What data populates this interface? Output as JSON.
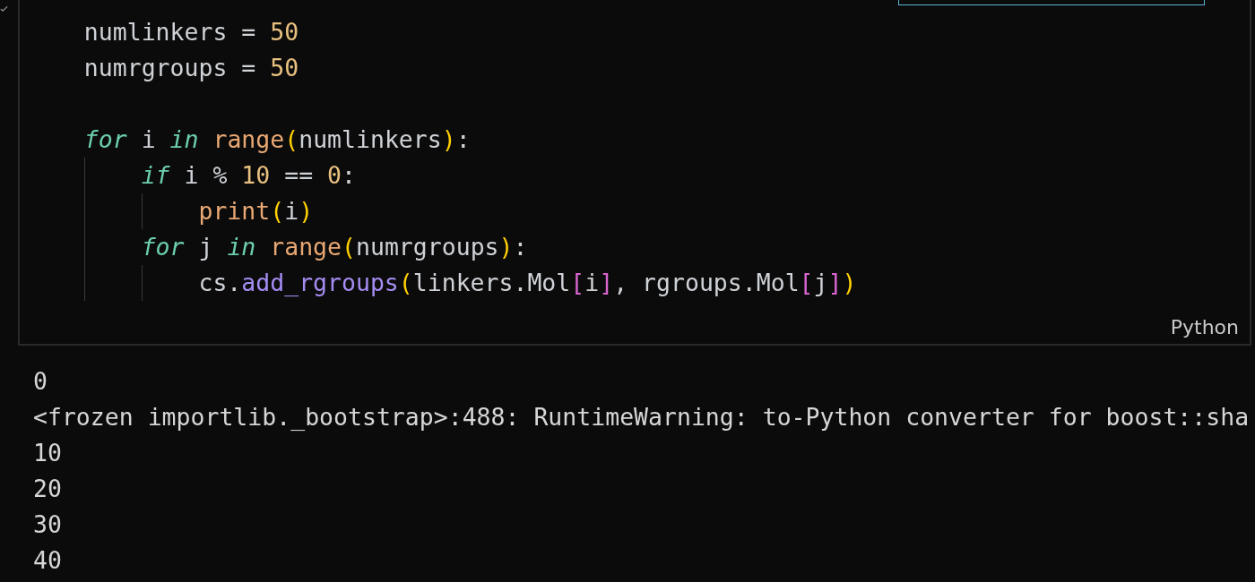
{
  "find_widget": {
    "visible": true
  },
  "cell": {
    "language": "Python",
    "code_lines": [
      {
        "kind": "code",
        "tokens": [
          {
            "kind": "plain",
            "text": "numlinkers = "
          },
          {
            "kind": "number",
            "text": "50"
          }
        ]
      },
      {
        "kind": "code",
        "tokens": [
          {
            "kind": "plain",
            "text": "numrgroups = "
          },
          {
            "kind": "number",
            "text": "50"
          }
        ]
      },
      {
        "kind": "blank"
      },
      {
        "kind": "code",
        "tokens": [
          {
            "kind": "keyword",
            "text": "for"
          },
          {
            "kind": "plain",
            "text": " i "
          },
          {
            "kind": "keyword",
            "text": "in"
          },
          {
            "kind": "function",
            "text": " range"
          },
          {
            "kind": "bracket1",
            "text": "("
          },
          {
            "kind": "plain",
            "text": "numlinkers"
          },
          {
            "kind": "bracket1",
            "text": ")"
          },
          {
            "kind": "plain",
            "text": ":"
          }
        ],
        "children": [
          {
            "kind": "code",
            "tokens": [
              {
                "kind": "keyword",
                "text": "if"
              },
              {
                "kind": "plain",
                "text": " i % "
              },
              {
                "kind": "number",
                "text": "10"
              },
              {
                "kind": "plain",
                "text": " == "
              },
              {
                "kind": "number",
                "text": "0"
              },
              {
                "kind": "plain",
                "text": ":"
              }
            ],
            "children": [
              {
                "kind": "code",
                "tokens": [
                  {
                    "kind": "function",
                    "text": "print"
                  },
                  {
                    "kind": "bracket1",
                    "text": "("
                  },
                  {
                    "kind": "plain",
                    "text": "i"
                  },
                  {
                    "kind": "bracket1",
                    "text": ")"
                  }
                ]
              }
            ]
          },
          {
            "kind": "code",
            "tokens": [
              {
                "kind": "keyword",
                "text": "for"
              },
              {
                "kind": "plain",
                "text": " j "
              },
              {
                "kind": "keyword",
                "text": "in"
              },
              {
                "kind": "function",
                "text": " range"
              },
              {
                "kind": "bracket1",
                "text": "("
              },
              {
                "kind": "plain",
                "text": "numrgroups"
              },
              {
                "kind": "bracket1",
                "text": ")"
              },
              {
                "kind": "plain",
                "text": ":"
              }
            ],
            "children": [
              {
                "kind": "code",
                "tokens": [
                  {
                    "kind": "plain",
                    "text": "cs."
                  },
                  {
                    "kind": "method",
                    "text": "add_rgroups"
                  },
                  {
                    "kind": "bracket1",
                    "text": "("
                  },
                  {
                    "kind": "plain",
                    "text": "linkers.Mol"
                  },
                  {
                    "kind": "bracket2",
                    "text": "["
                  },
                  {
                    "kind": "plain",
                    "text": "i"
                  },
                  {
                    "kind": "bracket2",
                    "text": "]"
                  },
                  {
                    "kind": "plain",
                    "text": ", rgroups.Mol"
                  },
                  {
                    "kind": "bracket2",
                    "text": "["
                  },
                  {
                    "kind": "plain",
                    "text": "j"
                  },
                  {
                    "kind": "bracket2",
                    "text": "]"
                  },
                  {
                    "kind": "bracket1",
                    "text": ")"
                  }
                ]
              }
            ]
          }
        ]
      }
    ]
  },
  "output_lines": [
    "0",
    "<frozen importlib._bootstrap>:488: RuntimeWarning: to-Python converter for boost::sha",
    "10",
    "20",
    "30",
    "40"
  ]
}
